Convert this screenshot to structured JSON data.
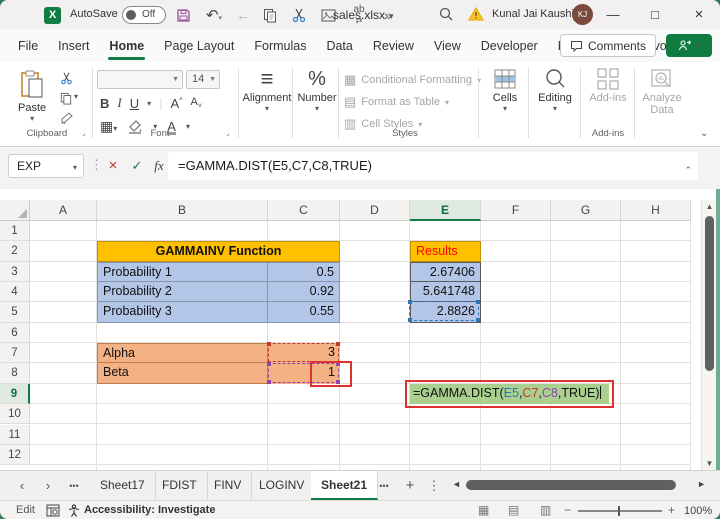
{
  "titlebar": {
    "autosave_label": "AutoSave",
    "autosave_state": "Off",
    "file_name": "sales.xlsx",
    "user_name": "Kunal Jai Kaushik",
    "user_initials": "KJ"
  },
  "ribbon": {
    "tabs": [
      "File",
      "Insert",
      "Home",
      "Page Layout",
      "Formulas",
      "Data",
      "Review",
      "View",
      "Developer",
      "Help",
      "Power Pivot"
    ],
    "active_tab": "Home",
    "comments_label": "Comments",
    "clipboard": {
      "paste_label": "Paste",
      "group_label": "Clipboard"
    },
    "font": {
      "size_value": "14",
      "bold": "B",
      "italic": "I",
      "underline": "U",
      "group_label": "Font"
    },
    "alignment_label": "Alignment",
    "number_label": "Number",
    "styles": {
      "items": [
        "Conditional Formatting",
        "Format as Table",
        "Cell Styles"
      ],
      "group_label": "Styles"
    },
    "cells_label": "Cells",
    "editing_label": "Editing",
    "addins_label": "Add-ins",
    "addins_group_label": "Add-ins",
    "analyze_label_1": "Analyze",
    "analyze_label_2": "Data"
  },
  "formula_bar": {
    "name_box_value": "EXP",
    "fx_label": "fx",
    "formula": "=GAMMA.DIST(E5,C7,C8,TRUE)"
  },
  "grid": {
    "columns": [
      "A",
      "B",
      "C",
      "D",
      "E",
      "F",
      "G",
      "H"
    ],
    "rows": [
      "1",
      "2",
      "3",
      "4",
      "5",
      "6",
      "7",
      "8",
      "9",
      "10",
      "11",
      "12"
    ],
    "selected_column": "E",
    "selected_row": "9"
  },
  "sheet": {
    "title_cell": "GAMMAINV Function",
    "prob_rows": [
      {
        "label": "Probability 1",
        "value": "0.5"
      },
      {
        "label": "Probability 2",
        "value": "0.92"
      },
      {
        "label": "Probability 3",
        "value": "0.55"
      }
    ],
    "params": [
      {
        "label": "Alpha",
        "value": "3"
      },
      {
        "label": "Beta",
        "value": "1"
      }
    ],
    "results_header": "Results",
    "results": [
      "2.67406",
      "5.641748",
      "2.8826"
    ],
    "formula_cell": {
      "part1": "=GAMMA.DIST(",
      "ref1": "E5",
      "comma1": ",",
      "ref2": "C7",
      "comma2": ",",
      "ref3": "C8",
      "part2": ",TRUE)"
    }
  },
  "sheet_tabs": {
    "tabs": [
      "Sheet17",
      "FDIST",
      "FINV",
      "LOGINV",
      "Sheet21"
    ],
    "active": "Sheet21"
  },
  "status_bar": {
    "mode": "Edit",
    "accessibility": "Accessibility: Investigate",
    "zoom_value": "100%"
  },
  "colors": {
    "accent_green": "#107C41",
    "header_yellow": "#FFC000",
    "table_blue": "#B4C6E7",
    "table_orange": "#F4B183",
    "formula_cell_green": "#A9D08E",
    "results_text_red": "#FF0000",
    "ref_blue": "#2E75B6",
    "ref_red": "#C0392B",
    "ref_purple": "#8E44AD",
    "annotation_red": "#E03131"
  }
}
